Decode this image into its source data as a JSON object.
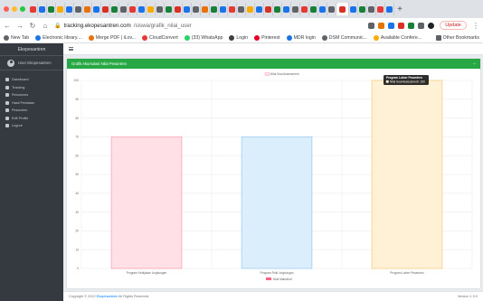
{
  "browser": {
    "url_host": "tracking.ekopesantren.com",
    "url_path": "/siswa/grafik_nilai_user",
    "update_label": "Update",
    "bookmarks": [
      {
        "label": "New Tab",
        "color": "#5f6368"
      },
      {
        "label": "Electronic library....",
        "color": "#1a73e8"
      },
      {
        "label": "Merge PDF | iLov...",
        "color": "#e8710a"
      },
      {
        "label": "CloudConvert",
        "color": "#e53935"
      },
      {
        "label": "(33) WhatsApp",
        "color": "#25d366"
      },
      {
        "label": "Login",
        "color": "#3c4043"
      },
      {
        "label": "Pinterest",
        "color": "#e60023"
      },
      {
        "label": "MDR login",
        "color": "#1a73e8"
      },
      {
        "label": "DSM Communic...",
        "color": "#5f6368"
      },
      {
        "label": "Available Confere...",
        "color": "#f9ab00"
      }
    ],
    "other_bookmarks": "Other Bookmarks"
  },
  "sidebar": {
    "brand": "Ekopesantren",
    "user": "User Ekopesantren",
    "items": [
      {
        "label": "Dashboard"
      },
      {
        "label": "Tracking"
      },
      {
        "label": "Resources"
      },
      {
        "label": "Hasil Penilaian"
      },
      {
        "label": "Pesantren"
      },
      {
        "label": "Edit Profile"
      },
      {
        "label": "Logout"
      }
    ]
  },
  "card": {
    "title": "Grafik Akumulasi Nilai Pesantren"
  },
  "footer": {
    "copyright_prefix": "Copyright © 2022 ",
    "copyright_link": "Ekopesantren",
    "copyright_suffix": " All Rights Reserved.",
    "version": "Version 1.0.0"
  },
  "chart_data": {
    "type": "bar",
    "categories": [
      "Program Kebijakan Lingkungan",
      "Program Fisik Lingkungan",
      "Program Lainer Pesantren"
    ],
    "series": [
      {
        "name": "Nilai Soal Assessment",
        "values": [
          70,
          70,
          100
        ]
      }
    ],
    "bar_colors": [
      "#ffe0e6",
      "#dbeefc",
      "#fff1d6"
    ],
    "bar_borders": [
      "#f7a6b6",
      "#9fcdf3",
      "#f5cf86"
    ],
    "ylim": [
      0,
      100
    ],
    "yticks": [
      0,
      10,
      20,
      30,
      40,
      50,
      60,
      70,
      80,
      90,
      100
    ],
    "grid": true,
    "legend_position": "top",
    "bottom_legend": "Nilai Maksimal",
    "bottom_legend_color": "#ff6384",
    "tooltip": {
      "title": "Program Lainer Pesantren",
      "line": "Nilai Soal Assessment: 100"
    }
  }
}
